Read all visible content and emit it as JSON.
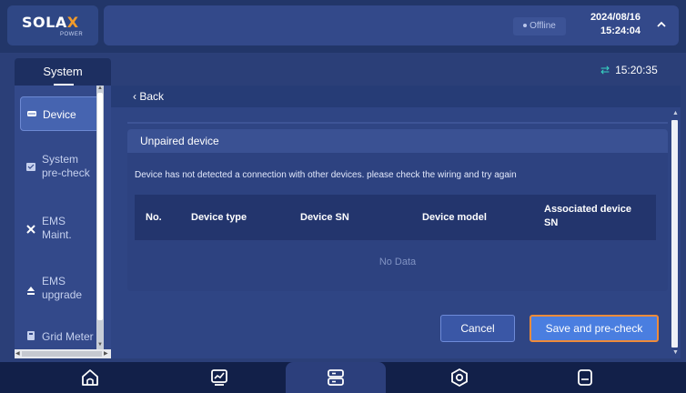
{
  "header": {
    "logo_text": "SOLA",
    "logo_x": "X",
    "logo_sub": "POWER",
    "status": "Offline",
    "date": "2024/08/16",
    "time": "15:24:04"
  },
  "subheader": {
    "tab_label": "System",
    "sync_time": "15:20:35"
  },
  "sidebar": {
    "items": [
      {
        "label": "Device",
        "icon": "device-icon"
      },
      {
        "label_line1": "System",
        "label_line2": "pre-check",
        "icon": "precheck-icon"
      },
      {
        "label_line1": "EMS",
        "label_line2": "Maint.",
        "icon": "wrench-icon"
      },
      {
        "label_line1": "EMS",
        "label_line2": "upgrade",
        "icon": "upload-icon"
      },
      {
        "label": "Grid Meter",
        "icon": "meter-icon"
      }
    ]
  },
  "main": {
    "back_label": "Back",
    "card_title": "Unpaired device",
    "message": "Device has not detected a connection with other devices. please check the wiring and try again",
    "columns": [
      "No.",
      "Device type",
      "Device SN",
      "Device model",
      "Associated device",
      "SN"
    ],
    "no_data": "No Data",
    "cancel_label": "Cancel",
    "save_label": "Save and pre-check"
  },
  "bottom_nav": {
    "items": [
      "home-icon",
      "monitor-icon",
      "system-icon",
      "settings-icon",
      "device-icon"
    ],
    "active_index": 2
  },
  "colors": {
    "accent": "#4a7ee0",
    "highlight_border": "#ef8b3a",
    "sync": "#37d6c3"
  }
}
